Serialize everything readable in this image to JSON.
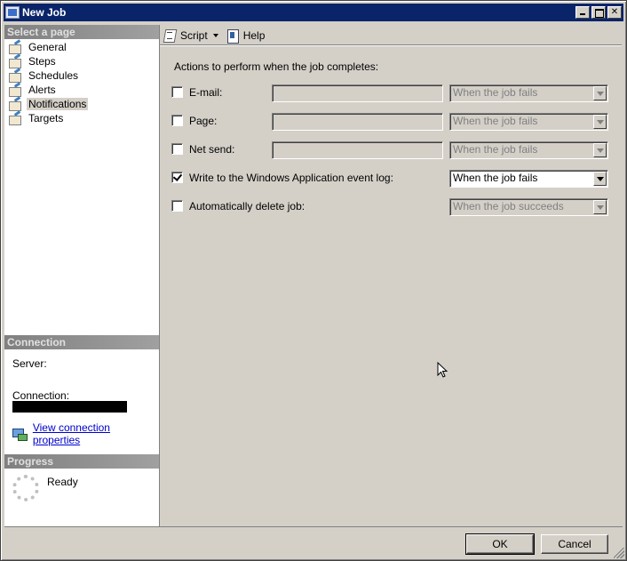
{
  "window": {
    "title": "New Job"
  },
  "left_panel": {
    "select_page_header": "Select a page",
    "pages": [
      {
        "label": "General",
        "selected": false
      },
      {
        "label": "Steps",
        "selected": false
      },
      {
        "label": "Schedules",
        "selected": false
      },
      {
        "label": "Alerts",
        "selected": false
      },
      {
        "label": "Notifications",
        "selected": true
      },
      {
        "label": "Targets",
        "selected": false
      }
    ],
    "connection_header": "Connection",
    "server_label": "Server:",
    "connection_label": "Connection:",
    "view_connection_link": "View connection properties",
    "progress_header": "Progress",
    "progress_status": "Ready"
  },
  "toolbar": {
    "script_label": "Script",
    "help_label": "Help"
  },
  "notifications": {
    "heading": "Actions to perform when the job completes:",
    "rows": [
      {
        "label": "E-mail:",
        "checked": false,
        "has_target": true,
        "target_value": "",
        "condition": "When the job fails",
        "enabled": false
      },
      {
        "label": "Page:",
        "checked": false,
        "has_target": true,
        "target_value": "",
        "condition": "When the job fails",
        "enabled": false
      },
      {
        "label": "Net send:",
        "checked": false,
        "has_target": true,
        "target_value": "",
        "condition": "When the job fails",
        "enabled": false
      },
      {
        "label": "Write to the Windows Application event log:",
        "checked": true,
        "has_target": false,
        "condition": "When the job fails",
        "enabled": true
      },
      {
        "label": "Automatically delete job:",
        "checked": false,
        "has_target": false,
        "condition": "When the job succeeds",
        "enabled": false
      }
    ]
  },
  "buttons": {
    "ok_label": "OK",
    "cancel_label": "Cancel"
  }
}
